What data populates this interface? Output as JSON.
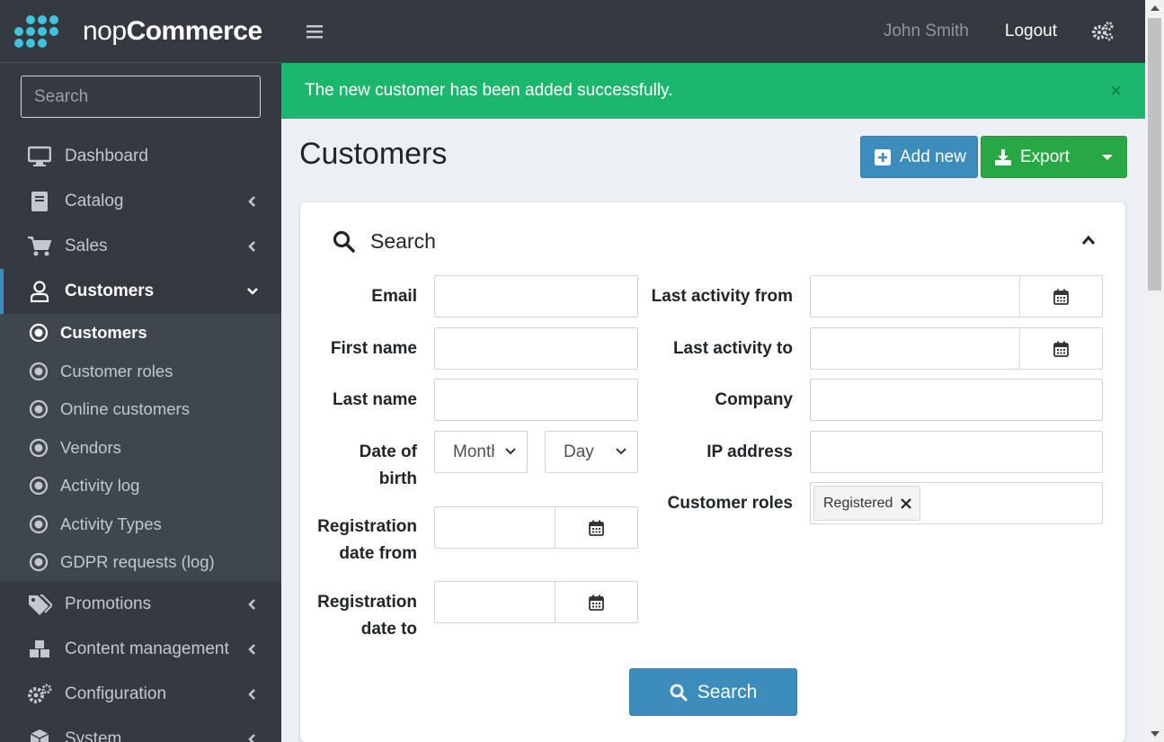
{
  "brand": {
    "name_part1": "nop",
    "name_part2": "Commerce"
  },
  "sidebar": {
    "search_placeholder": "Search",
    "items": [
      {
        "label": "Dashboard",
        "icon": "monitor-icon"
      },
      {
        "label": "Catalog",
        "icon": "book-icon"
      },
      {
        "label": "Sales",
        "icon": "cart-icon"
      },
      {
        "label": "Customers",
        "icon": "user-icon"
      },
      {
        "label": "Promotions",
        "icon": "tags-icon"
      },
      {
        "label": "Content management",
        "icon": "cubes-icon"
      },
      {
        "label": "Configuration",
        "icon": "gears-icon"
      },
      {
        "label": "System",
        "icon": "cube-icon"
      }
    ],
    "customers_sub": [
      {
        "label": "Customers"
      },
      {
        "label": "Customer roles"
      },
      {
        "label": "Online customers"
      },
      {
        "label": "Vendors"
      },
      {
        "label": "Activity log"
      },
      {
        "label": "Activity Types"
      },
      {
        "label": "GDPR requests (log)"
      }
    ]
  },
  "header": {
    "user": "John Smith",
    "logout": "Logout"
  },
  "alert": {
    "message": "The new customer has been added successfully.",
    "close": "×"
  },
  "page": {
    "title": "Customers",
    "add_new_label": "Add new",
    "export_label": "Export"
  },
  "search_panel": {
    "title": "Search",
    "fields": {
      "email": "Email",
      "first_name": "First name",
      "last_name": "Last name",
      "date_of_birth_line1": "Date of",
      "date_of_birth_line2": "birth",
      "month_value": "Month",
      "day_value": "Day",
      "reg_from_line1": "Registration",
      "reg_from_line2": "date from",
      "reg_to_line1": "Registration",
      "reg_to_line2": "date to",
      "last_activity_from": "Last activity from",
      "last_activity_to": "Last activity to",
      "company": "Company",
      "ip_address": "IP address",
      "customer_roles": "Customer roles",
      "role_tag": "Registered"
    },
    "search_button": "Search"
  },
  "colors": {
    "sidebar_bg": "#343a40",
    "alert_green": "#1bb76e",
    "primary_blue": "#3c8dbc",
    "export_green": "#28a745"
  }
}
